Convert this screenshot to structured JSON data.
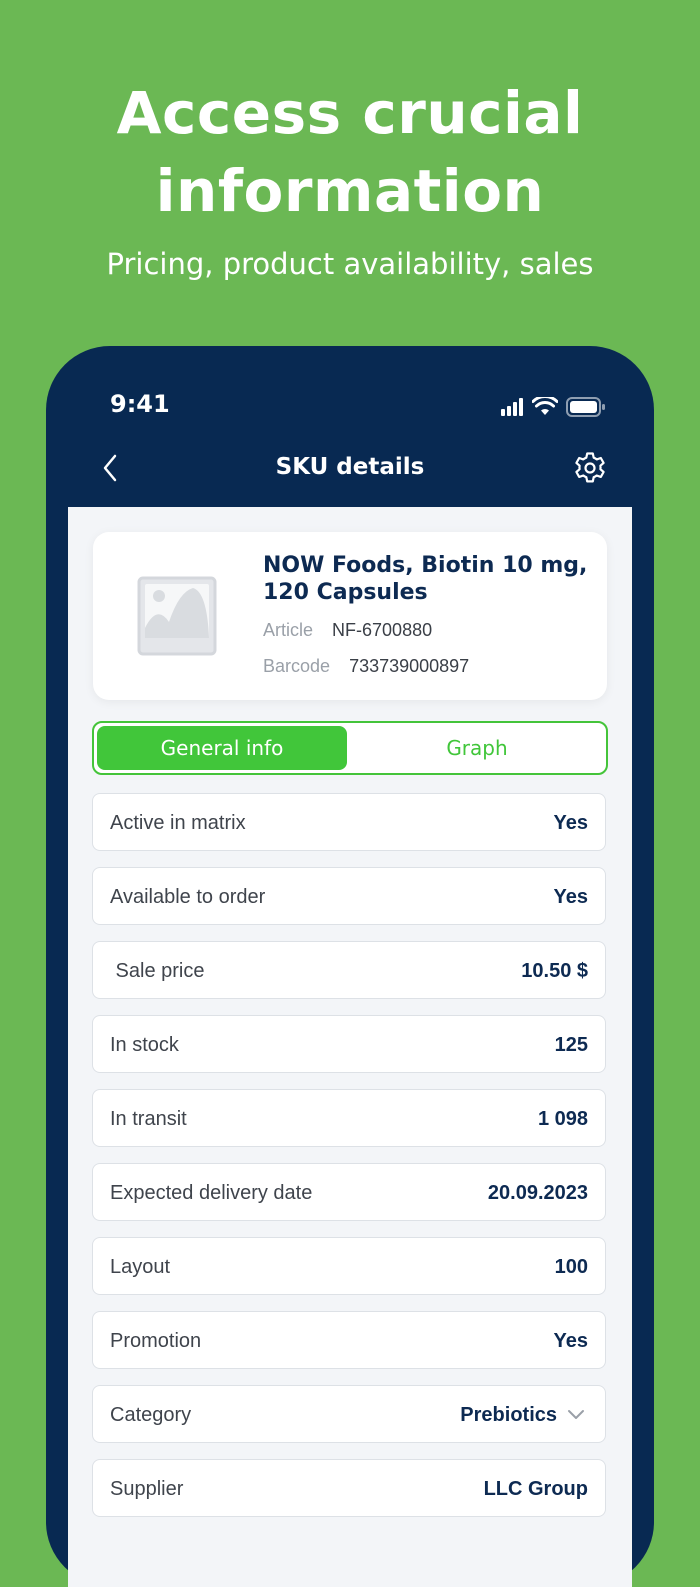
{
  "hero": {
    "title_line1": "Access crucial",
    "title_line2": "information",
    "subtitle": "Pricing, product availability, sales"
  },
  "status_bar": {
    "time": "9:41"
  },
  "nav": {
    "title": "SKU details",
    "back_icon": "chevron-left-icon",
    "settings_icon": "gear-icon"
  },
  "product": {
    "name": "NOW Foods, Biotin 10 mg, 120 Capsules",
    "article_label": "Article",
    "article_value": "NF-6700880",
    "barcode_label": "Barcode",
    "barcode_value": "733739000897"
  },
  "tabs": [
    {
      "label": "General info",
      "active": true
    },
    {
      "label": "Graph",
      "active": false
    }
  ],
  "details": [
    {
      "label": "Active in matrix",
      "value": "Yes"
    },
    {
      "label": "Available to order",
      "value": "Yes"
    },
    {
      "label": " Sale price",
      "value": "10.50 $"
    },
    {
      "label": "In stock",
      "value": "125"
    },
    {
      "label": "In transit",
      "value": "1 098"
    },
    {
      "label": "Expected delivery date",
      "value": "20.09.2023"
    },
    {
      "label": "Layout",
      "value": "100"
    },
    {
      "label": "Promotion",
      "value": "Yes"
    },
    {
      "label": "Category",
      "value": "Prebiotics"
    },
    {
      "label": "Supplier",
      "value": "LLC Group"
    }
  ],
  "colors": {
    "background_green": "#6bb854",
    "phone_navy": "#082952",
    "accent_green": "#41c63a",
    "value_navy": "#0d2a52"
  }
}
